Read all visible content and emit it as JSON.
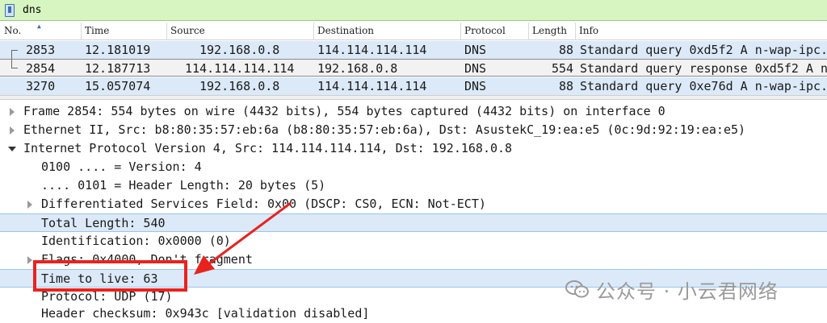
{
  "filter": {
    "text": "dns"
  },
  "columns": [
    "No.",
    "Time",
    "Source",
    "Destination",
    "Protocol",
    "Length",
    "Info"
  ],
  "packets": [
    {
      "no": "2853",
      "time": "12.181019",
      "source": "192.168.0.8",
      "destination": "114.114.114.114",
      "protocol": "DNS",
      "length": "88",
      "info": "Standard query 0xd5f2 A n-wap-ipc."
    },
    {
      "no": "2854",
      "time": "12.187713",
      "source": "114.114.114.114",
      "destination": "192.168.0.8",
      "protocol": "DNS",
      "length": "554",
      "info": "Standard query response 0xd5f2 A n"
    },
    {
      "no": "3270",
      "time": "15.057074",
      "source": "192.168.0.8",
      "destination": "114.114.114.114",
      "protocol": "DNS",
      "length": "88",
      "info": "Standard query 0xe76d A n-wap-ipc."
    }
  ],
  "details": [
    {
      "text": "Frame 2854: 554 bytes on wire (4432 bits), 554 bytes captured (4432 bits) on interface 0"
    },
    {
      "text": "Ethernet II, Src: b8:80:35:57:eb:6a (b8:80:35:57:eb:6a), Dst: AsustekC_19:ea:e5 (0c:9d:92:19:ea:e5)"
    },
    {
      "text": "Internet Protocol Version 4, Src: 114.114.114.114, Dst: 192.168.0.8"
    },
    {
      "text": "0100 .... = Version: 4"
    },
    {
      "text": ".... 0101 = Header Length: 20 bytes (5)"
    },
    {
      "text": "Differentiated Services Field: 0x00 (DSCP: CS0, ECN: Not-ECT)"
    },
    {
      "text": "Total Length: 540"
    },
    {
      "text": "Identification: 0x0000 (0)"
    },
    {
      "text": "Flags: 0x4000, Don't fragment"
    },
    {
      "text": "Time to live: 63"
    },
    {
      "text": "Protocol: UDP (17)"
    },
    {
      "text": "Header checksum: 0x943c [validation disabled]"
    }
  ],
  "watermark": {
    "text": "公众号 · 小云君网络"
  },
  "colors": {
    "filter_bg": "#d6f5c0",
    "selected_row": "#dbe9f8",
    "annotation": "#e8231e"
  }
}
